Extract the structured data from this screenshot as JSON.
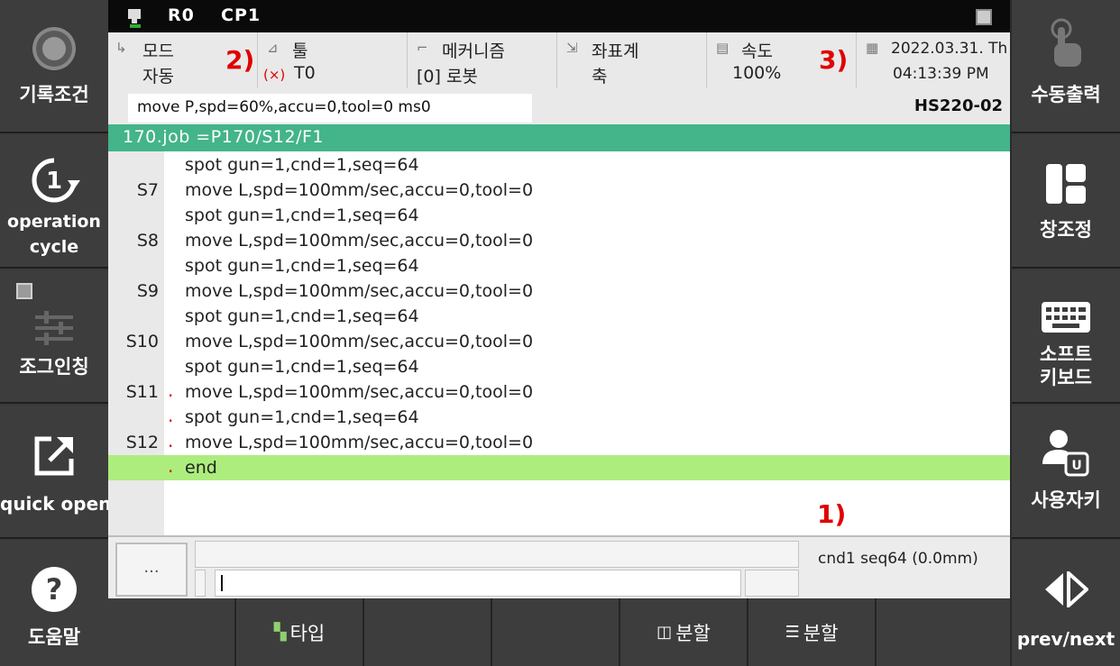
{
  "status_bar": {
    "robot": "R0",
    "cp": "CP1"
  },
  "info": {
    "mode": {
      "label": "모드",
      "value": "자동"
    },
    "tool": {
      "label": "툴",
      "status_icon": "(×)",
      "value": "T0"
    },
    "mechanism": {
      "label": "메커니즘",
      "value": "[0] 로봇"
    },
    "coord": {
      "label": "좌표계",
      "value": "축"
    },
    "speed": {
      "label": "속도",
      "value": "100%"
    },
    "datetime": {
      "date": "2022.03.31. Th",
      "time": "04:13:39 PM"
    }
  },
  "annotations": {
    "a1": "1)",
    "a2": "2)",
    "a3": "3)"
  },
  "command": "move P,spd=60%,accu=0,tool=0 ms0",
  "model": "HS220-02",
  "job_header": "170.job  =P170/S12/F1",
  "program": [
    {
      "step": "",
      "dot": "",
      "code": "spot gun=1,cnd=1,seq=64"
    },
    {
      "step": "S7",
      "dot": "",
      "code": "move L,spd=100mm/sec,accu=0,tool=0"
    },
    {
      "step": "",
      "dot": "",
      "code": "spot gun=1,cnd=1,seq=64"
    },
    {
      "step": "S8",
      "dot": "",
      "code": "move L,spd=100mm/sec,accu=0,tool=0"
    },
    {
      "step": "",
      "dot": "",
      "code": "spot gun=1,cnd=1,seq=64"
    },
    {
      "step": "S9",
      "dot": "",
      "code": "move L,spd=100mm/sec,accu=0,tool=0"
    },
    {
      "step": "",
      "dot": "",
      "code": "spot gun=1,cnd=1,seq=64"
    },
    {
      "step": "S10",
      "dot": "",
      "code": "move L,spd=100mm/sec,accu=0,tool=0"
    },
    {
      "step": "",
      "dot": "",
      "code": "spot gun=1,cnd=1,seq=64"
    },
    {
      "step": "S11",
      "dot": ".",
      "code": "move L,spd=100mm/sec,accu=0,tool=0"
    },
    {
      "step": "",
      "dot": ".",
      "code": "spot gun=1,cnd=1,seq=64"
    },
    {
      "step": "S12",
      "dot": ".",
      "code": "move L,spd=100mm/sec,accu=0,tool=0"
    },
    {
      "step": "",
      "dot": ".",
      "code": "end"
    }
  ],
  "bottom": {
    "dots_button": "...",
    "status": "cnd1 seq64 (0.0mm)"
  },
  "left_buttons": [
    "기록조건",
    "operation cycle",
    "조그인칭",
    "quick open",
    "도움말"
  ],
  "right_buttons": [
    "수동출력",
    "창조정",
    "소프트 키보드",
    "사용자키",
    "prev/next"
  ],
  "function_keys": [
    "",
    "타입",
    "",
    "",
    "분할",
    "분할",
    ""
  ],
  "colors": {
    "job_header": "#44b48a",
    "current_line": "#aded7e",
    "annotation": "#e00000"
  }
}
